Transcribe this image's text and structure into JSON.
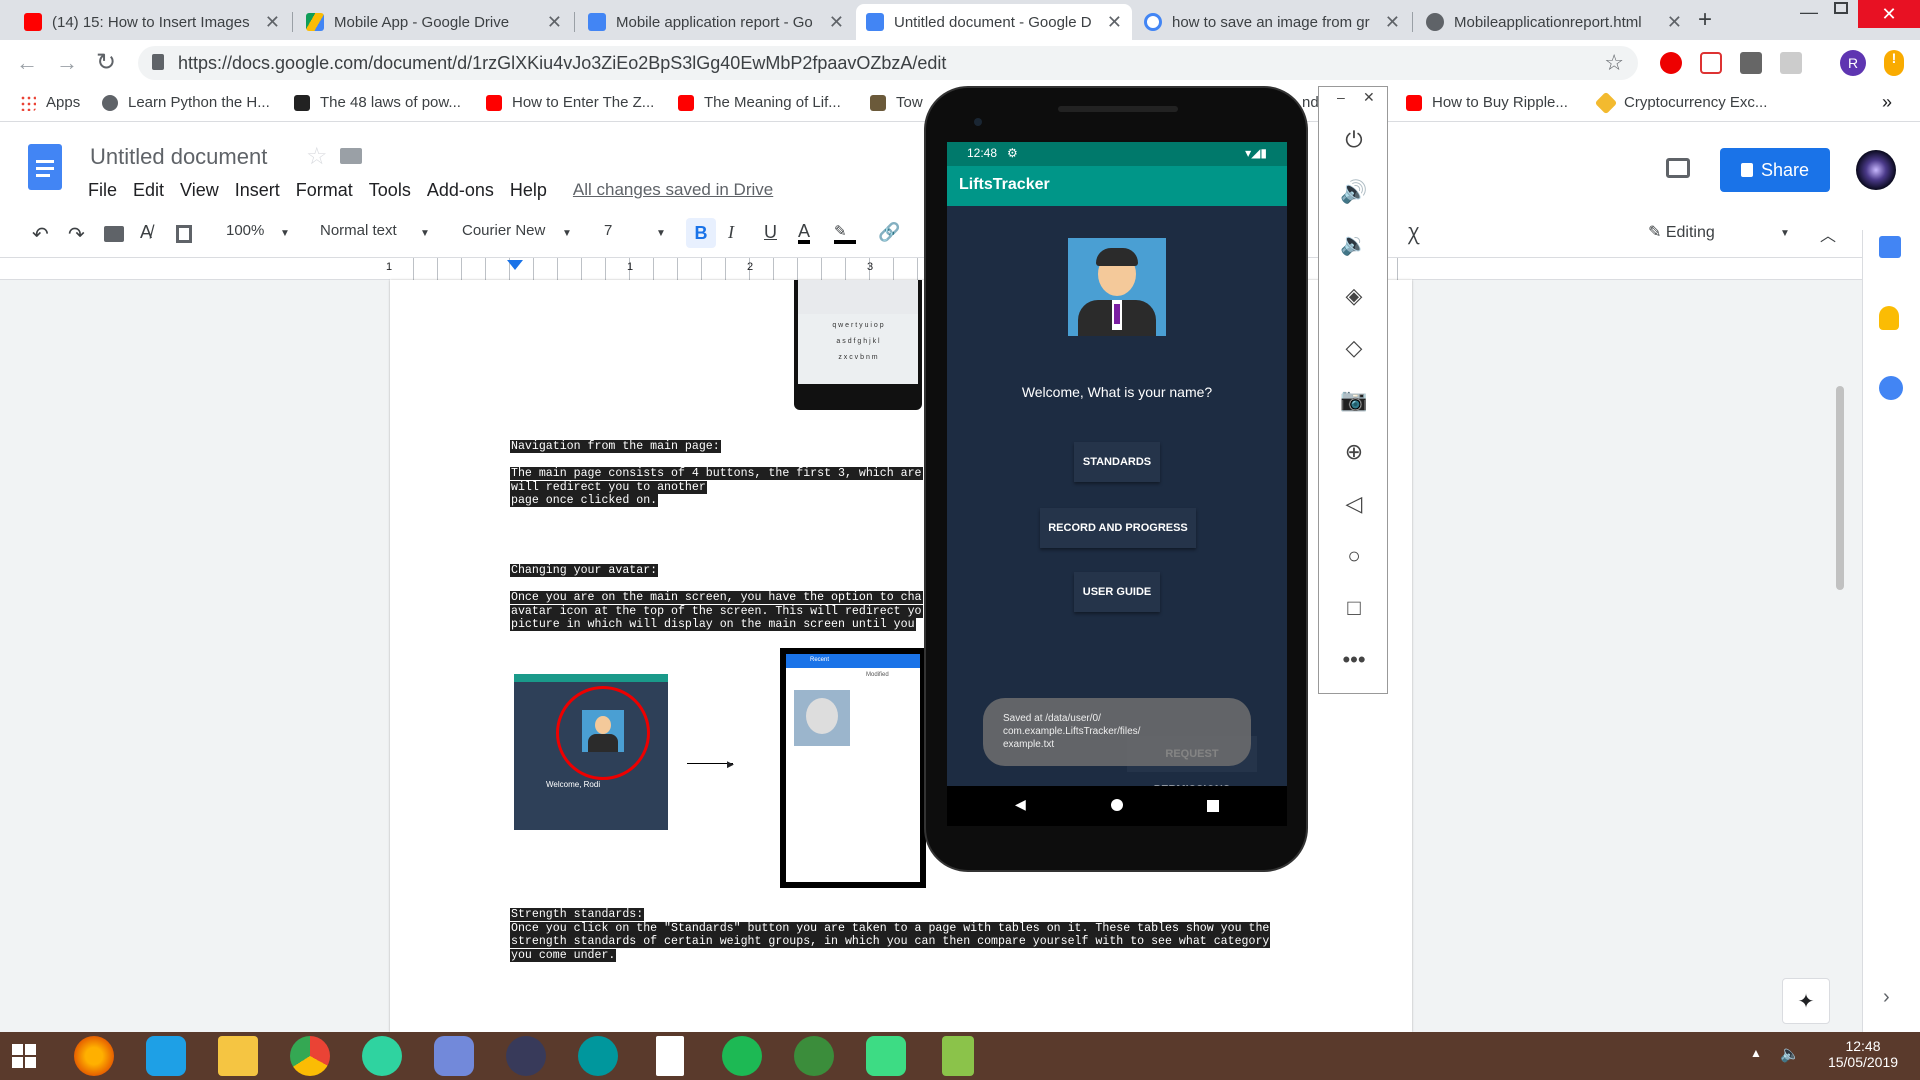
{
  "tabs": [
    {
      "title": "(14) 15: How to Insert Images",
      "color": "#ff0000"
    },
    {
      "title": "Mobile App - Google Drive",
      "color": "#fbbc04"
    },
    {
      "title": "Mobile application report - Go",
      "color": "#4285f4"
    },
    {
      "title": "Untitled document - Google D",
      "color": "#4285f4"
    },
    {
      "title": "how to save an image from gr",
      "color": "#4285f4"
    },
    {
      "title": "Mobileapplicationreport.html",
      "color": "#5f6368"
    }
  ],
  "url": "https://docs.google.com/document/d/1rzGlXKiu4vJo3ZiEo2BpS3lGg40EwMbP2fpaavOZbzA/edit",
  "bookmarks": [
    {
      "label": "Apps"
    },
    {
      "label": "Learn Python the H..."
    },
    {
      "label": "The 48 laws of pow..."
    },
    {
      "label": "How to Enter The Z..."
    },
    {
      "label": "The Meaning of Lif..."
    },
    {
      "label": "Tow"
    },
    {
      "label": "nd"
    },
    {
      "label": "How to Buy Ripple..."
    },
    {
      "label": "Cryptocurrency Exc..."
    }
  ],
  "docs": {
    "title": "Untitled document",
    "menu": [
      "File",
      "Edit",
      "View",
      "Insert",
      "Format",
      "Tools",
      "Add-ons",
      "Help"
    ],
    "saved": "All changes saved in Drive",
    "share": "Share",
    "editing": "Editing",
    "avatar_letter": "R"
  },
  "toolbar": {
    "zoom": "100%",
    "style": "Normal text",
    "font": "Courier New",
    "size": "7",
    "bold": "B",
    "italic": "I",
    "underline": "U",
    "textcolor": "A"
  },
  "ruler": [
    "1",
    "1",
    "2",
    "3"
  ],
  "doc_text": {
    "kbd_rows": [
      "q w e r t y u i o p",
      "a s d f g h j k l",
      "z x c v b n m"
    ],
    "nav_heading": "Navigation from the main page:",
    "nav_body": [
      "The main page consists of 4 buttons, the first 3, which are",
      "will redirect you to another",
      "page once clicked on."
    ],
    "avatar_heading": "Changing your avatar:",
    "avatar_body": [
      "Once you are on the main screen, you have the option to cha",
      "avatar icon at the top of the screen. This will redirect yo",
      "picture in which will display on the main screen until you"
    ],
    "fig_welcome": "Welcome, Rodi",
    "fig_recent": "Recent",
    "fig_modified": "Modified",
    "strength_heading": "Strength standards:",
    "strength_body": [
      "Once you click on the \"Standards\" button you are taken to a page with tables on it. These tables show you the",
      "strength standards of certain weight groups, in which you can then compare yourself with to see what category",
      "you come under."
    ]
  },
  "app": {
    "status_time": "12:48",
    "app_name": "LiftsTracker",
    "welcome": "Welcome, What is your name?",
    "buttons": [
      "STANDARDS",
      "RECORD AND PROGRESS",
      "USER GUIDE"
    ],
    "toast": [
      "Saved at /data/user/0/",
      "com.example.LiftsTracker/files/",
      "example.txt"
    ],
    "request_btn": "REQUEST PERMISSIONS"
  },
  "emulator_controls": [
    "power-icon",
    "volume-up-icon",
    "volume-down-icon",
    "rotate-left-icon",
    "rotate-right-icon",
    "camera-icon",
    "zoom-icon",
    "back-icon",
    "home-icon",
    "overview-icon",
    "more-icon"
  ],
  "taskbar": {
    "time": "12:48",
    "date": "15/05/2019"
  }
}
